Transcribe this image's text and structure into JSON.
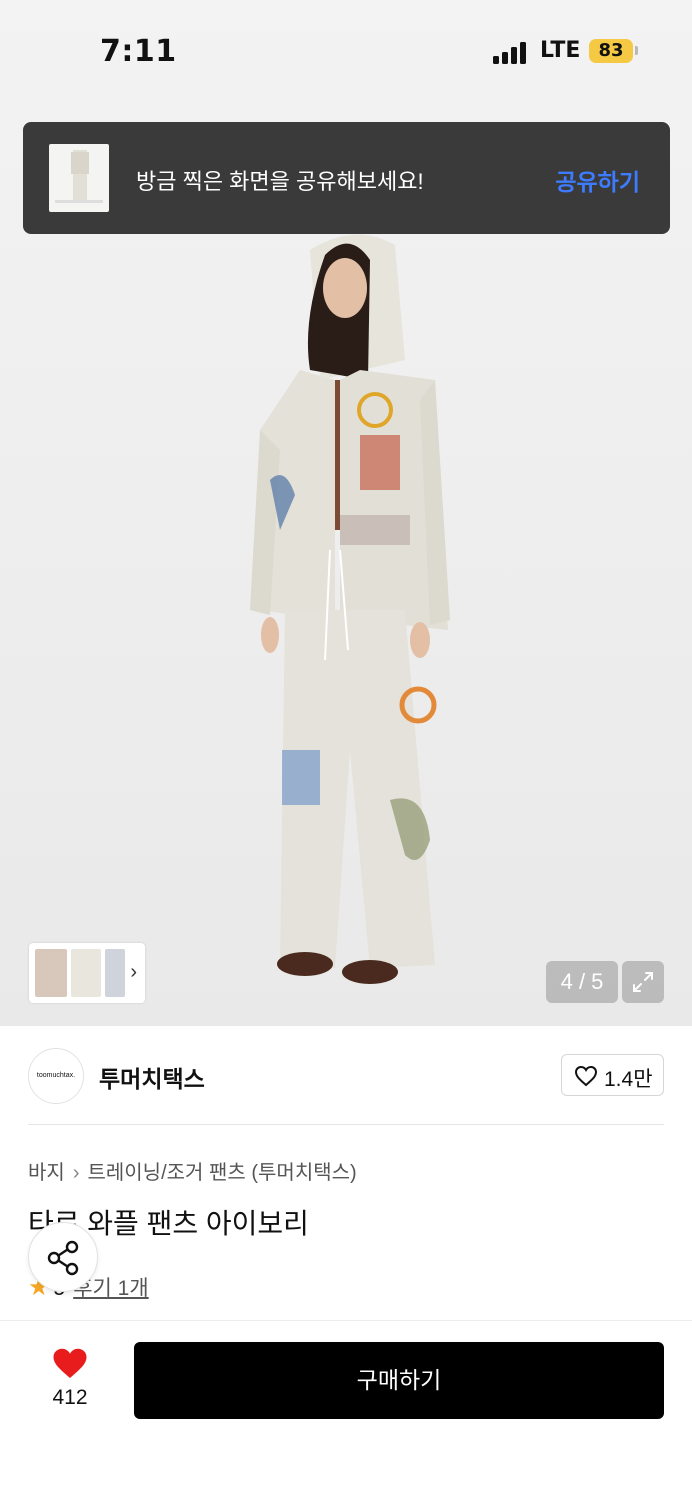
{
  "status_bar": {
    "time": "7:11",
    "network": "LTE",
    "battery": "83"
  },
  "toast": {
    "message": "방금 찍은 화면을 공유해보세요!",
    "action_label": "공유하기"
  },
  "gallery": {
    "counter": "4 / 5",
    "thumb_chevron": "›"
  },
  "brand": {
    "logo_text": "toomuchtax.",
    "name": "투머치택스",
    "like_count": "1.4만"
  },
  "product": {
    "breadcrumb": [
      "바지",
      "트레이닝/조거 팬츠 (투머치택스)"
    ],
    "title": "타로 와플 팬츠 아이보리",
    "rating_score": "5",
    "review_label": "후기 1개"
  },
  "bottom_bar": {
    "wish_count": "412",
    "buy_label": "구매하기"
  },
  "colors": {
    "accent_blue": "#3d7bff",
    "heart_red": "#e81c1c",
    "toast_bg": "#3a3a3a",
    "buy_bg": "#000000",
    "battery": "#f6c944"
  },
  "icons": [
    "signal-icon",
    "battery-icon",
    "heart-outline-icon",
    "heart-filled-icon",
    "share-icon",
    "expand-icon",
    "star-icon",
    "chevron-right-icon"
  ]
}
